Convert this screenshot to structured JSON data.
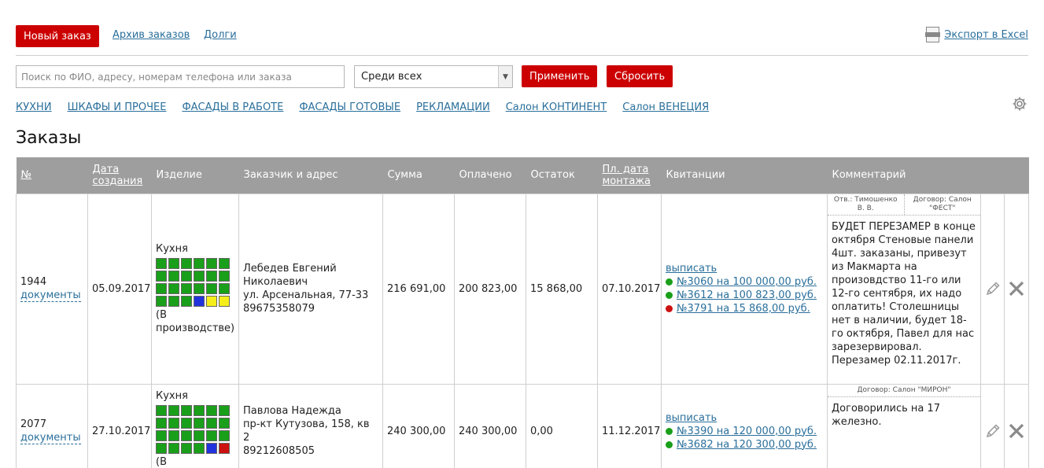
{
  "toolbar": {
    "new_order": "Новый заказ",
    "archive": "Архив заказов",
    "debts": "Долги",
    "export": "Экспорт в Excel",
    "export_icon": "xls-file-icon"
  },
  "search": {
    "placeholder": "Поиск по ФИО, адресу, номерам телефона или заказа",
    "value": "",
    "scope": "Среди всех",
    "apply": "Применить",
    "reset": "Сбросить"
  },
  "filters": [
    "КУХНИ",
    "ШКАФЫ И ПРОЧЕЕ",
    "ФАСАДЫ В РАБОТЕ",
    "ФАСАДЫ ГОТОВЫЕ",
    "РЕКЛАМАЦИИ",
    "Салон КОНТИНЕНТ",
    "Салон ВЕНЕЦИЯ"
  ],
  "page_title": "Заказы",
  "colors": {
    "accent": "#cc0000",
    "link": "#2a6f9b",
    "header_bg": "#9e9e9e",
    "green": "#1a9f1a",
    "blue": "#2233dd",
    "yellow": "#f5ee1a",
    "red": "#cc1111"
  },
  "table": {
    "headers": {
      "num": "№",
      "created_1": "Дата",
      "created_2": "создания",
      "product": "Изделие",
      "customer": "Заказчик и адрес",
      "sum": "Сумма",
      "paid": "Оплачено",
      "rest": "Остаток",
      "mount_1": "Пл. дата",
      "mount_2": "монтажа",
      "receipts": "Квитанции",
      "comment": "Комментарий"
    },
    "rows": [
      {
        "num": "1944",
        "docs": "документы",
        "created": "05.09.2017",
        "product": "Кухня",
        "status": "(В производстве)",
        "dots": [
          "green",
          "green",
          "green",
          "green",
          "green",
          "green",
          "green",
          "green",
          "green",
          "green",
          "green",
          "green",
          "green",
          "green",
          "green",
          "green",
          "green",
          "green",
          "green",
          "green",
          "green",
          "blue",
          "yellow",
          "yellow"
        ],
        "customer_name": "Лебедев Евгений Николаевич",
        "customer_address": "ул. Арсенальная, 77-33",
        "customer_phone": "89675358079",
        "sum": "216 691,00",
        "paid": "200 823,00",
        "rest": "15 868,00",
        "mount_date": "07.10.2017",
        "issue": "выписать",
        "receipts": [
          {
            "text": "№3060 на 100 000,00 руб.",
            "status": "green"
          },
          {
            "text": "№3612 на 100 823,00 руб.",
            "status": "green"
          },
          {
            "text": "№3791 на 15 868,00 руб.",
            "status": "red"
          }
        ],
        "meta_resp": "Отв.: Тимошенко В. В.",
        "meta_contract": "Договор: Салон \"ФЕСТ\"",
        "comment": "БУДЕТ ПЕРЕЗАМЕР в конце октября Стеновые панели 4шт. заказаны, привезут из Макмарта на произовдство 11-го или 12-го сентября, их надо оплатить! Столешницы нет в наличии, будет 18-го октября, Павел для нас зарезервировал. Перезамер 02.11.2017г."
      },
      {
        "num": "2077",
        "docs": "документы",
        "created": "27.10.2017",
        "product": "Кухня",
        "status": "(В",
        "dots": [
          "green",
          "green",
          "green",
          "green",
          "green",
          "green",
          "green",
          "green",
          "green",
          "green",
          "green",
          "green",
          "green",
          "green",
          "green",
          "green",
          "green",
          "green",
          "green",
          "green",
          "green",
          "green",
          "blue",
          "red"
        ],
        "customer_name": "Павлова Надежда",
        "customer_address": "пр-кт Кутузова, 158, кв 2",
        "customer_phone": "89212608505",
        "sum": "240 300,00",
        "paid": "240 300,00",
        "rest": "0,00",
        "mount_date": "11.12.2017",
        "issue": "выписать",
        "receipts": [
          {
            "text": "№3390 на 120 000,00 руб.",
            "status": "green"
          },
          {
            "text": "№3682 на 120 300,00 руб.",
            "status": "green"
          }
        ],
        "meta_contract": "Договор: Салон \"МИРОН\"",
        "comment": "Договорились на 17 железно."
      }
    ]
  }
}
